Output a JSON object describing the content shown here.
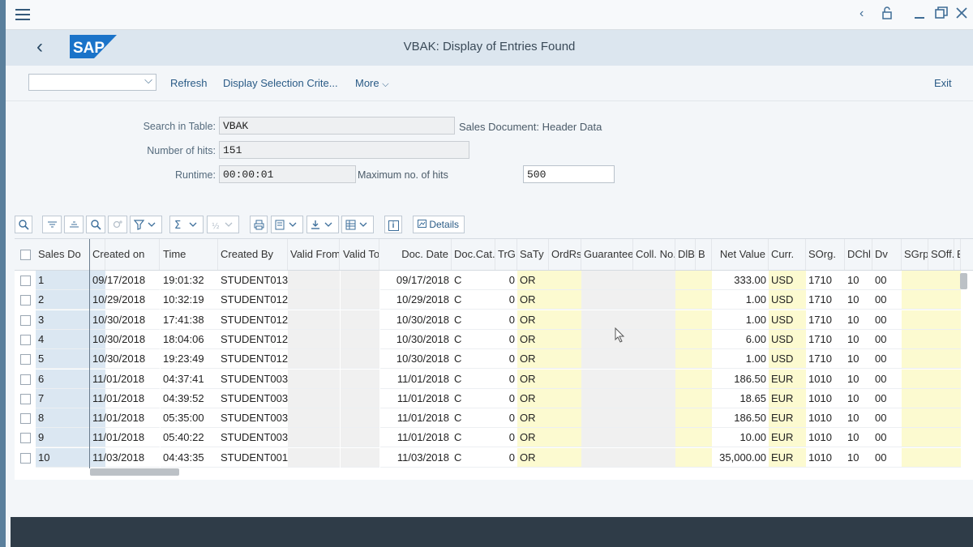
{
  "header": {
    "title": "VBAK: Display of Entries Found"
  },
  "toolbar": {
    "select_value": "",
    "refresh": "Refresh",
    "display_selection": "Display Selection Crite...",
    "more": "More",
    "exit": "Exit"
  },
  "form": {
    "search_label": "Search in Table:",
    "search_value": "VBAK",
    "search_desc": "Sales Document: Header Data",
    "hits_label": "Number of hits:",
    "hits_value": "151",
    "runtime_label": "Runtime:",
    "runtime_value": "00:00:01",
    "max_label": "Maximum no. of hits",
    "max_value": "500"
  },
  "grid_toolbar": {
    "details": "Details",
    "info_icon": "i"
  },
  "table": {
    "headers": [
      "Sales Do",
      "Created on",
      "Time",
      "Created By",
      "Valid From",
      "Valid To",
      "Doc. Date",
      "Doc.Cat.",
      "TrG",
      "SaTy",
      "OrdRs",
      "Guarantee",
      "Coll. No.",
      "DlBl",
      "B",
      "Net Value",
      "Curr.",
      "SOrg.",
      "DChl",
      "Dv",
      "SGrp",
      "SOff.",
      "B"
    ],
    "rows": [
      [
        "1",
        "09/17/2018",
        "19:01:32",
        "STUDENT013",
        "",
        "",
        "09/17/2018",
        "C",
        "0",
        "OR",
        "",
        "",
        "",
        "",
        "",
        "333.00",
        "USD",
        "1710",
        "10",
        "00",
        "",
        "",
        ""
      ],
      [
        "2",
        "10/29/2018",
        "10:32:19",
        "STUDENT012",
        "",
        "",
        "10/29/2018",
        "C",
        "0",
        "OR",
        "",
        "",
        "",
        "",
        "",
        "1.00",
        "USD",
        "1710",
        "10",
        "00",
        "",
        "",
        ""
      ],
      [
        "3",
        "10/30/2018",
        "17:41:38",
        "STUDENT012",
        "",
        "",
        "10/30/2018",
        "C",
        "0",
        "OR",
        "",
        "",
        "",
        "",
        "",
        "1.00",
        "USD",
        "1710",
        "10",
        "00",
        "",
        "",
        ""
      ],
      [
        "4",
        "10/30/2018",
        "18:04:06",
        "STUDENT012",
        "",
        "",
        "10/30/2018",
        "C",
        "0",
        "OR",
        "",
        "",
        "",
        "",
        "",
        "6.00",
        "USD",
        "1710",
        "10",
        "00",
        "",
        "",
        ""
      ],
      [
        "5",
        "10/30/2018",
        "19:23:49",
        "STUDENT012",
        "",
        "",
        "10/30/2018",
        "C",
        "0",
        "OR",
        "",
        "",
        "",
        "",
        "",
        "1.00",
        "USD",
        "1710",
        "10",
        "00",
        "",
        "",
        ""
      ],
      [
        "6",
        "11/01/2018",
        "04:37:41",
        "STUDENT003",
        "",
        "",
        "11/01/2018",
        "C",
        "0",
        "OR",
        "",
        "",
        "",
        "",
        "",
        "186.50",
        "EUR",
        "1010",
        "10",
        "00",
        "",
        "",
        ""
      ],
      [
        "7",
        "11/01/2018",
        "04:39:52",
        "STUDENT003",
        "",
        "",
        "11/01/2018",
        "C",
        "0",
        "OR",
        "",
        "",
        "",
        "",
        "",
        "18.65",
        "EUR",
        "1010",
        "10",
        "00",
        "",
        "",
        ""
      ],
      [
        "8",
        "11/01/2018",
        "05:35:00",
        "STUDENT003",
        "",
        "",
        "11/01/2018",
        "C",
        "0",
        "OR",
        "",
        "",
        "",
        "",
        "",
        "186.50",
        "EUR",
        "1010",
        "10",
        "00",
        "",
        "",
        ""
      ],
      [
        "9",
        "11/01/2018",
        "05:40:22",
        "STUDENT003",
        "",
        "",
        "11/01/2018",
        "C",
        "0",
        "OR",
        "",
        "",
        "",
        "",
        "",
        "10.00",
        "EUR",
        "1010",
        "10",
        "00",
        "",
        "",
        ""
      ],
      [
        "10",
        "11/03/2018",
        "04:43:35",
        "STUDENT001",
        "",
        "",
        "11/03/2018",
        "C",
        "0",
        "OR",
        "",
        "",
        "",
        "",
        "",
        "35,000.00",
        "EUR",
        "1010",
        "10",
        "00",
        "",
        "",
        ""
      ]
    ]
  },
  "colors": {
    "header_bar": "#dce6ef",
    "footer": "#2f3c48",
    "key_column": "#dbe7f2",
    "highlight": "#fcfad0",
    "link": "#2a5b86"
  }
}
